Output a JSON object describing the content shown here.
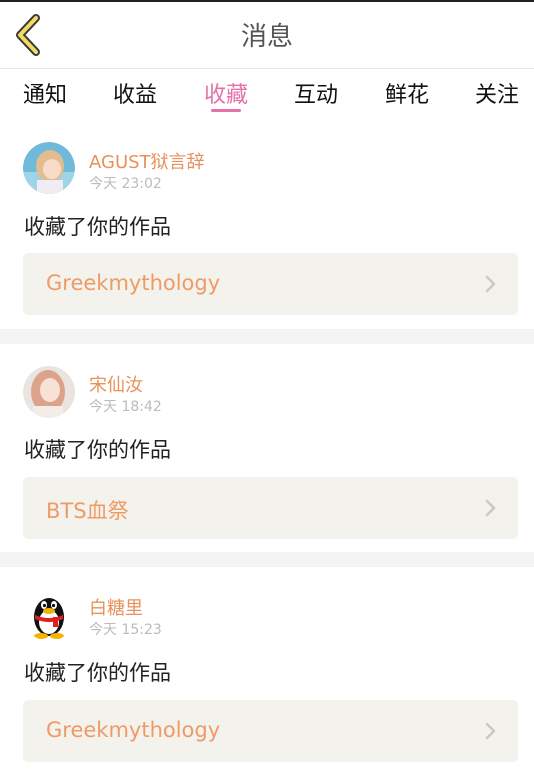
{
  "header": {
    "title": "消息"
  },
  "tabs": [
    "通知",
    "收益",
    "收藏",
    "互动",
    "鲜花",
    "关注"
  ],
  "active_tab": "收藏",
  "accent_color": "#e472a8",
  "name_color": "#e8915a",
  "messages": [
    {
      "avatar": "girl-photo-avatar",
      "user": "AGUST狱言辞",
      "time": "今天 23:02",
      "action": "收藏了你的作品",
      "work": "Greekmythology"
    },
    {
      "avatar": "girl-photo-avatar",
      "user": "宋仙汝",
      "time": "今天 18:42",
      "action": "收藏了你的作品",
      "work": "BTS血祭"
    },
    {
      "avatar": "qq-penguin-avatar",
      "user": "白糖里",
      "time": "今天 15:23",
      "action": "收藏了你的作品",
      "work": "Greekmythology"
    }
  ]
}
